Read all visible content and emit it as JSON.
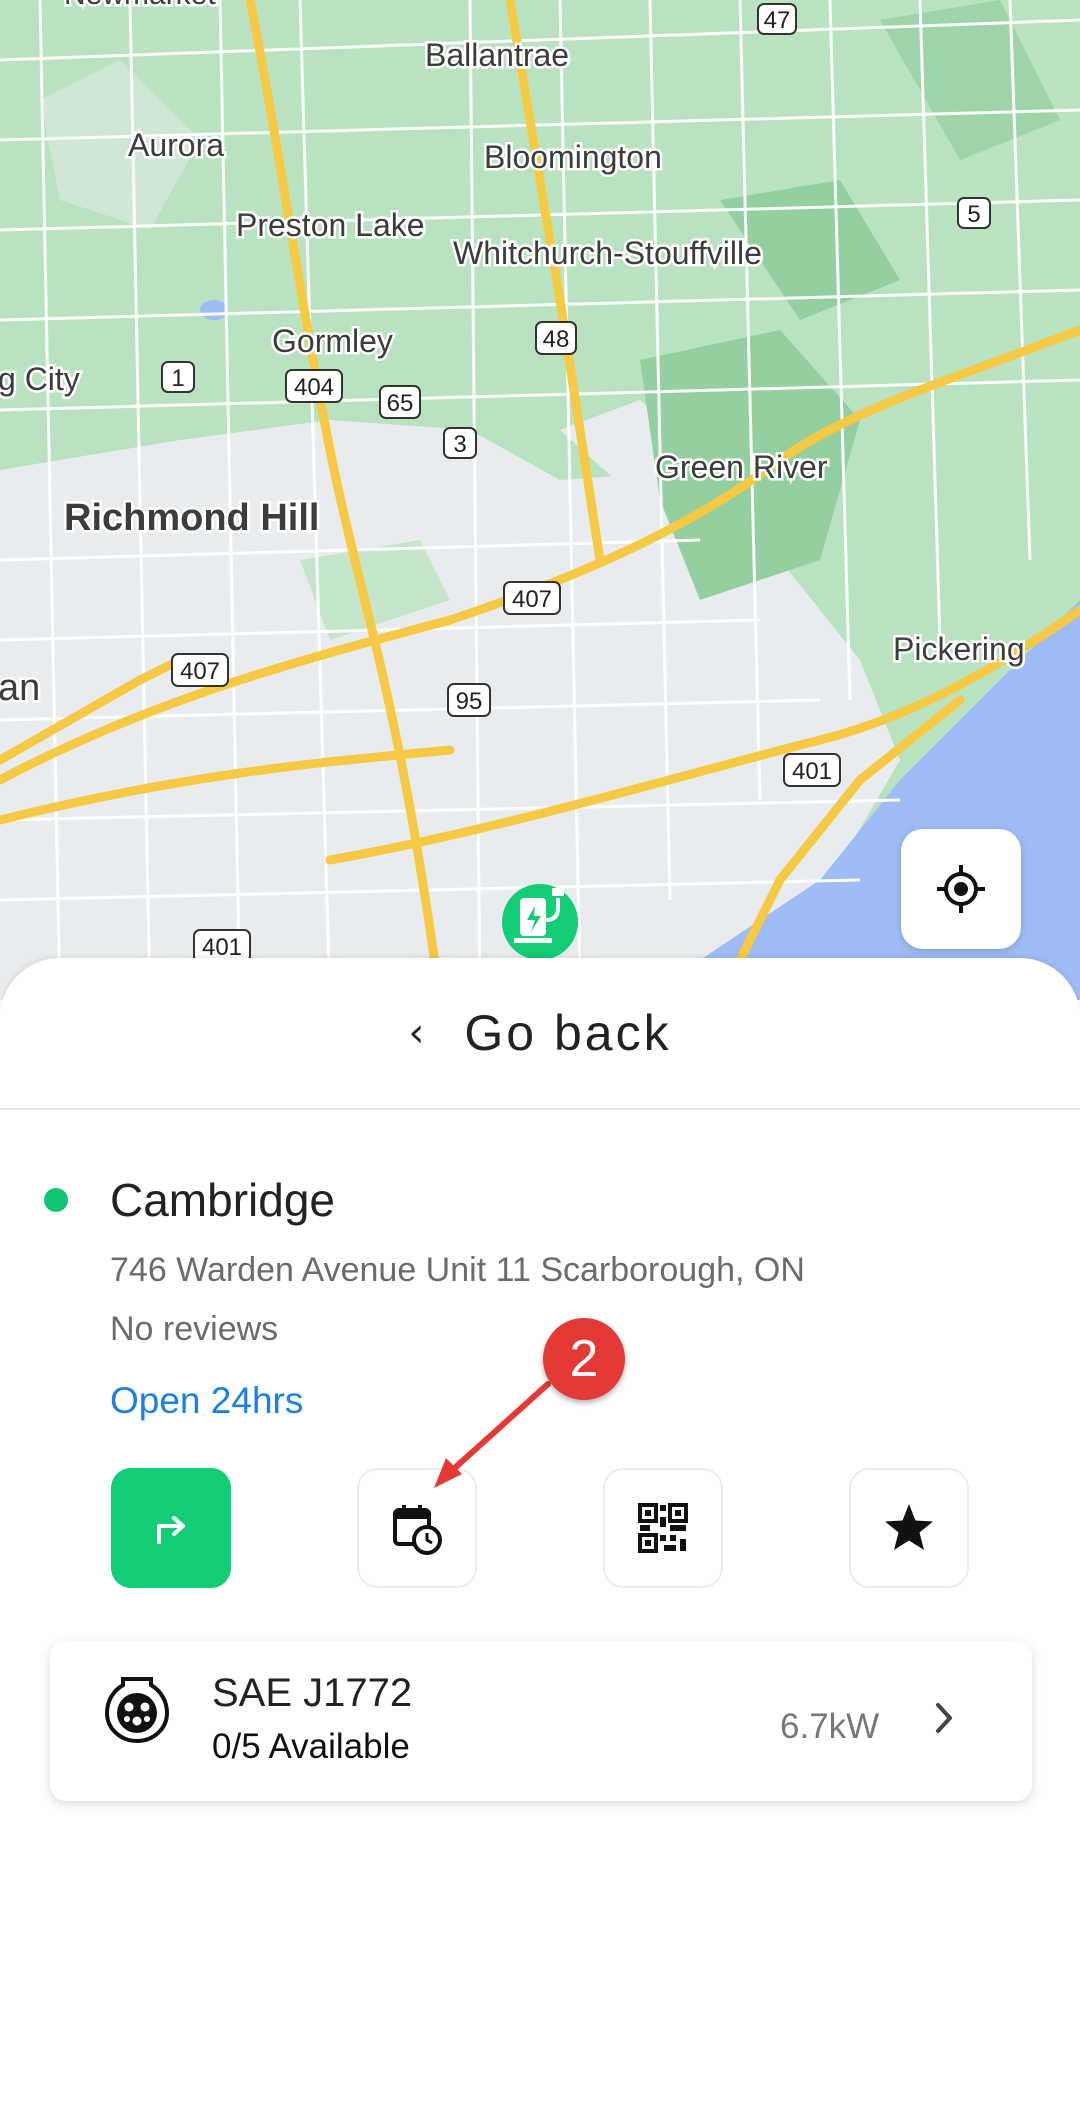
{
  "map": {
    "places": [
      "Ballantrae",
      "Aurora",
      "Bloomington",
      "Preston Lake",
      "Whitchurch-Stouffville",
      "Gormley",
      "Richmond Hill",
      "Green River",
      "Pickering",
      "g City",
      "an",
      "Newmarket"
    ],
    "route_shields": [
      "47",
      "5",
      "48",
      "1",
      "404",
      "65",
      "3",
      "407",
      "407",
      "95",
      "401",
      "401"
    ],
    "locate_icon": "crosshair-icon",
    "marker_icon": "ev-charger-icon"
  },
  "sheet": {
    "back_label": "Go back",
    "station": {
      "name": "Cambridge",
      "address": "746 Warden Avenue Unit 11 Scarborough, ON",
      "reviews": "No reviews",
      "hours": "Open 24hrs",
      "status_color": "#13c46e"
    },
    "actions": [
      {
        "icon": "directions-icon"
      },
      {
        "icon": "calendar-clock-icon"
      },
      {
        "icon": "qr-code-icon"
      },
      {
        "icon": "star-icon"
      }
    ],
    "connector": {
      "type": "SAE J1772",
      "availability": "0/5 Available",
      "power": "6.7kW"
    }
  },
  "annotation": {
    "number": "2",
    "color": "#e53935"
  },
  "colors": {
    "accent_green": "#13cc76",
    "link_blue": "#1a80e6",
    "map_green": "#aedcb6",
    "water": "#9ebdf7",
    "highway": "#f6c944"
  }
}
